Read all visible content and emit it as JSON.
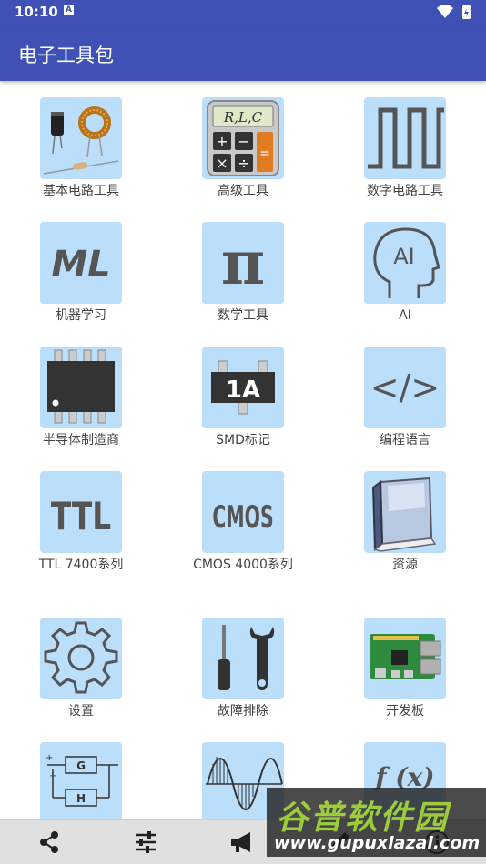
{
  "status_bar": {
    "time": "10:10",
    "notification_glyph": "A"
  },
  "app_bar": {
    "title": "电子工具包"
  },
  "tiles": [
    {
      "label": "基本电路工具",
      "icon": "components-icon"
    },
    {
      "label": "高级工具",
      "icon": "calculator-icon",
      "icon_text": "R,L,C"
    },
    {
      "label": "数字电路工具",
      "icon": "square-wave-icon"
    },
    {
      "label": "机器学习",
      "icon": "ml-icon",
      "icon_text": "ML"
    },
    {
      "label": "数学工具",
      "icon": "pi-icon",
      "icon_text": "π"
    },
    {
      "label": "AI",
      "icon": "ai-head-icon",
      "icon_text": "AI"
    },
    {
      "label": "半导体制造商",
      "icon": "ic-chip-icon"
    },
    {
      "label": "SMD标记",
      "icon": "smd-icon",
      "icon_text": "1A"
    },
    {
      "label": "编程语言",
      "icon": "code-icon",
      "icon_text": "</>"
    },
    {
      "label": "TTL 7400系列",
      "icon": "ttl-icon",
      "icon_text": "TTL"
    },
    {
      "label": "CMOS 4000系列",
      "icon": "cmos-icon",
      "icon_text": "CMOS"
    },
    {
      "label": "资源",
      "icon": "book-icon"
    },
    {
      "label": "设置",
      "icon": "gear-icon"
    },
    {
      "label": "故障排除",
      "icon": "tools-icon"
    },
    {
      "label": "开发板",
      "icon": "board-icon"
    },
    {
      "label": "",
      "icon": "control-loop-icon",
      "icon_text_g": "G",
      "icon_text_h": "H"
    },
    {
      "label": "",
      "icon": "sine-wave-icon"
    },
    {
      "label": "",
      "icon": "function-icon",
      "icon_text": "f (x)"
    }
  ],
  "bottom_bar": {
    "items": [
      "share-icon",
      "sliders-icon",
      "megaphone-icon",
      "pen-icon",
      "info-icon"
    ]
  },
  "watermark": {
    "title": "谷普软件园",
    "url": "www.gupuxlazal.com"
  },
  "colors": {
    "primary": "#3f51b5",
    "tile_bg": "#bbdefb",
    "icon_gray": "#555555"
  }
}
